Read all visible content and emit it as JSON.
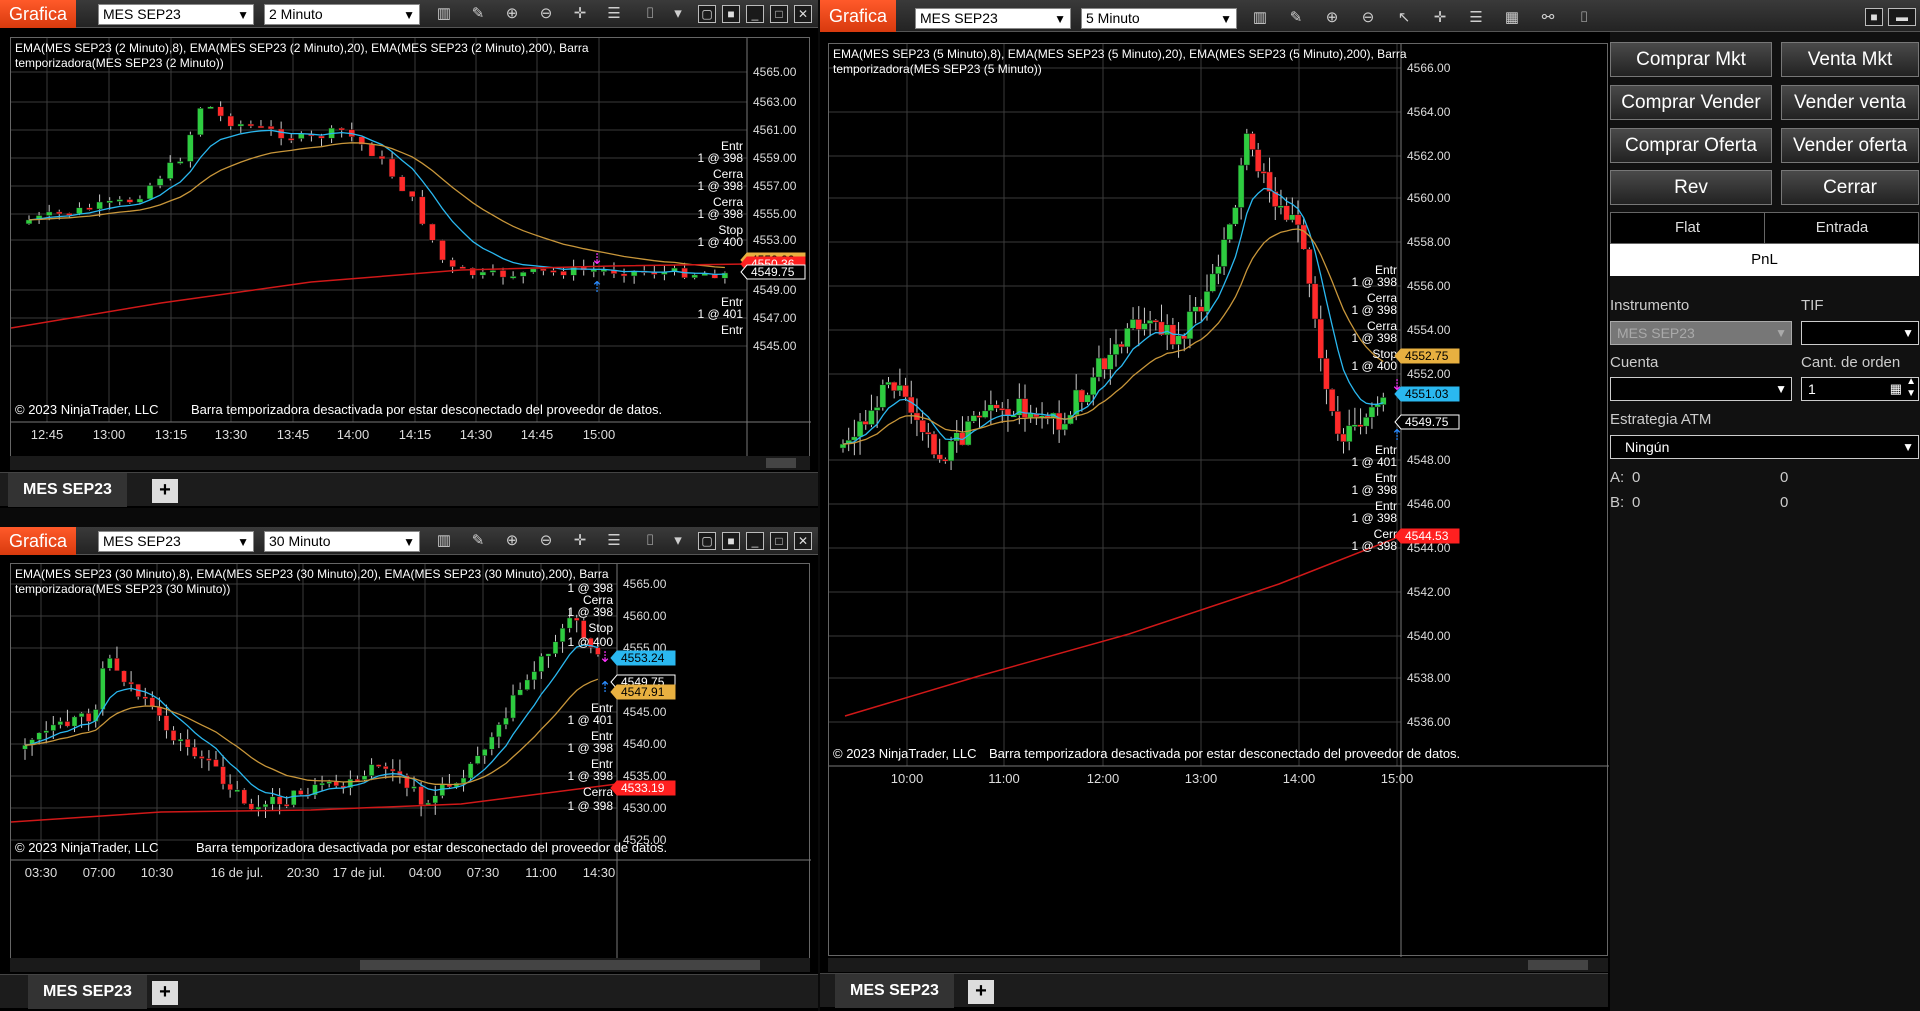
{
  "common": {
    "title": "Grafica",
    "instrument": "MES SEP23",
    "copyright": "© 2023 NinjaTrader, LLC",
    "disconnected": "Barra temporizadora desactivada por estar desconectado del proveedor de datos.",
    "tab_label": "MES SEP23",
    "add_tab": "+"
  },
  "w2": {
    "interval": "2 Minuto",
    "ind1": "EMA(MES SEP23 (2 Minuto),8), EMA(MES SEP23 (2 Minuto),20), EMA(MES SEP23 (2 Minuto),200), Barra",
    "ind2": "temporizadora(MES SEP23 (2 Minuto))",
    "yticks": [
      "4565.00",
      "4563.00",
      "4561.00",
      "4559.00",
      "4557.00",
      "4555.00",
      "4553.00",
      "4549.00",
      "4547.00",
      "4545.00"
    ],
    "xticks": [
      "12:45",
      "13:00",
      "13:15",
      "13:30",
      "13:45",
      "14:00",
      "14:15",
      "14:30",
      "14:45",
      "15:00"
    ],
    "markers": [
      {
        "t": "4552.22",
        "c": "#e8b040"
      },
      {
        "t": "4550.36",
        "c": "#ff2020"
      },
      {
        "t": "4549.75",
        "c": "#000"
      }
    ],
    "orders": [
      "Entr",
      "1 @ 398",
      "Cerra",
      "1 @ 398",
      "Cerra",
      "1 @ 398",
      "Stop",
      "1 @ 400",
      "Entr",
      "1 @ 401",
      "Entr"
    ]
  },
  "w30": {
    "interval": "30 Minuto",
    "ind1": "EMA(MES SEP23 (30 Minuto),8), EMA(MES SEP23 (30 Minuto),20), EMA(MES SEP23 (30 Minuto),200), Barra",
    "ind2": "temporizadora(MES SEP23 (30 Minuto))",
    "yticks": [
      "4565.00",
      "4560.00",
      "4555.00",
      "4545.00",
      "4540.00",
      "4535.00",
      "4530.00",
      "4525.00"
    ],
    "xticks": [
      "03:30",
      "07:00",
      "10:30",
      "16 de jul.",
      "20:30",
      "17 de jul.",
      "04:00",
      "07:30",
      "11:00",
      "14:30"
    ],
    "markers": [
      {
        "t": "4553.24",
        "c": "#2ab8f0"
      },
      {
        "t": "4549.75",
        "c": "#000"
      },
      {
        "t": "4547.91",
        "c": "#e8b040"
      },
      {
        "t": "4533.19",
        "c": "#ff2020"
      }
    ],
    "orders": [
      "1 @ 398",
      "Cerra",
      "1 @ 398",
      "Stop",
      "1 @ 400",
      "Entr",
      "1 @ 401",
      "Entr",
      "1 @ 398",
      "Entr",
      "1 @ 398",
      "Cerra",
      "1 @ 398"
    ]
  },
  "w5": {
    "interval": "5 Minuto",
    "ind1": "EMA(MES SEP23 (5 Minuto),8), EMA(MES SEP23 (5 Minuto),20), EMA(MES SEP23 (5 Minuto),200), Barra",
    "ind2": "temporizadora(MES SEP23 (5 Minuto))",
    "yticks": [
      "4566.00",
      "4564.00",
      "4562.00",
      "4560.00",
      "4558.00",
      "4556.00",
      "4554.00",
      "4552.00",
      "4548.00",
      "4546.00",
      "4544.00",
      "4542.00",
      "4540.00",
      "4538.00",
      "4536.00"
    ],
    "xticks": [
      "10:00",
      "11:00",
      "12:00",
      "13:00",
      "14:00",
      "15:00"
    ],
    "markers": [
      {
        "t": "4552.75",
        "c": "#e8b040"
      },
      {
        "t": "4551.03",
        "c": "#2ab8f0"
      },
      {
        "t": "4549.75",
        "c": "#000"
      },
      {
        "t": "4544.53",
        "c": "#ff2020"
      }
    ],
    "orders": [
      "Entr",
      "1 @ 398",
      "Cerra",
      "1 @ 398",
      "Cerra",
      "1 @ 398",
      "Stop",
      "1 @ 400",
      "Entr",
      "1 @ 401",
      "Entr",
      "1 @ 398",
      "Entr",
      "1 @ 398",
      "Cerr",
      "1 @ 398"
    ]
  },
  "panel": {
    "buttons": [
      "Comprar Mkt",
      "Venta Mkt",
      "Comprar Vender",
      "Vender venta",
      "Comprar Oferta",
      "Vender oferta",
      "Rev",
      "Cerrar"
    ],
    "pos_flat": "Flat",
    "pos_entry": "Entrada",
    "pnl": "PnL",
    "instr_label": "Instrumento",
    "tif_label": "TIF",
    "instr_value": "MES SEP23",
    "account_label": "Cuenta",
    "qty_label": "Cant. de orden",
    "qty_value": "1",
    "atm_label": "Estrategia ATM",
    "atm_value": "Ningún",
    "a_label": "A:",
    "a_v1": "0",
    "a_v2": "0",
    "b_label": "B:",
    "b_v1": "0",
    "b_v2": "0"
  },
  "colors": {
    "up": "#2ecc40",
    "down": "#ff2a2a",
    "ema8": "#2ab8f0",
    "ema20": "#c8963a",
    "ema200": "#d01818",
    "grid": "#3a3a3a"
  }
}
